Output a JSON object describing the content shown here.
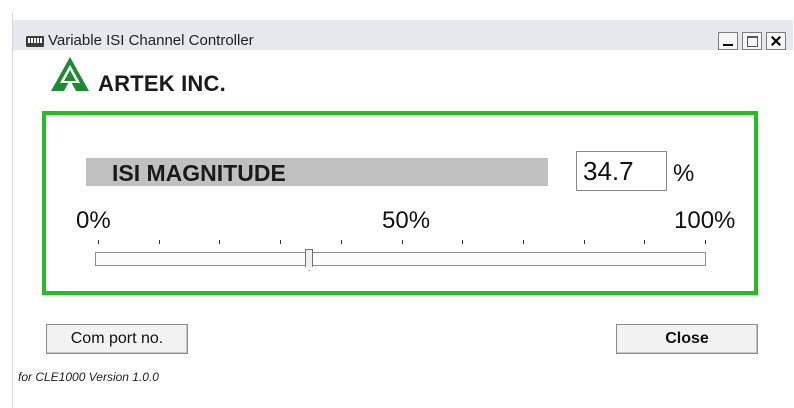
{
  "window": {
    "title": "Variable ISI Channel Controller",
    "icon": "app-window-icon",
    "controls": [
      "minimize-icon",
      "maximize-icon",
      "close-icon"
    ]
  },
  "logo": {
    "text": "ARTEK INC.",
    "color": "#1f8a34"
  },
  "panel": {
    "border_color": "#22c01e",
    "magnitude_label": "ISI MAGNITUDE",
    "magnitude_value": "34.7",
    "magnitude_unit": "%",
    "slider": {
      "min_label": "0%",
      "mid_label": "50%",
      "max_label": "100%",
      "value_percent": 34.7,
      "tick_count": 11
    }
  },
  "buttons": {
    "com_port": "Com port no.",
    "close": "Close"
  },
  "footer": {
    "version_text": "for CLE1000 Version 1.0.0"
  }
}
